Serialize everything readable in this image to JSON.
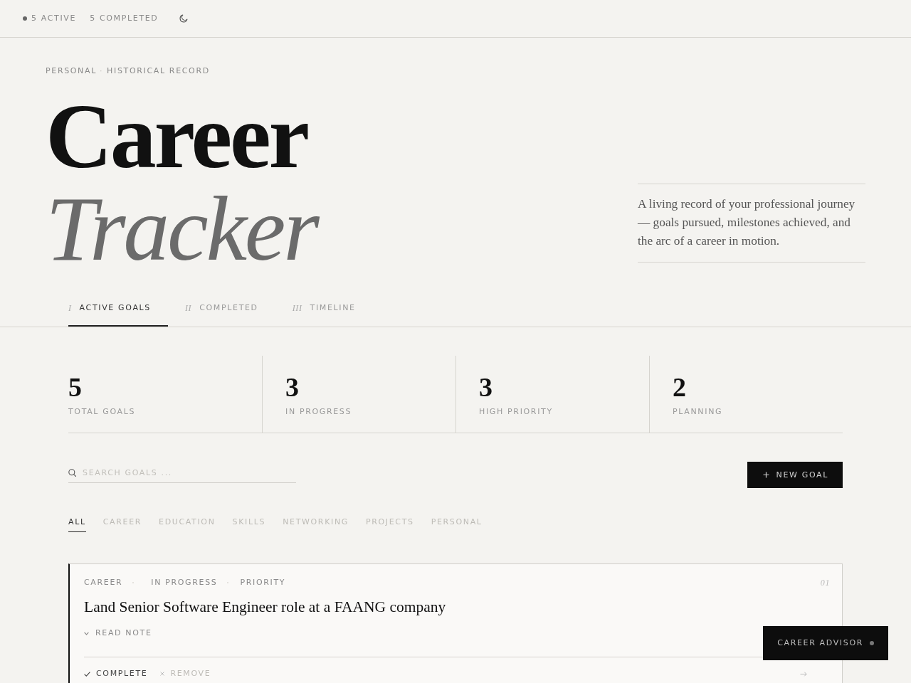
{
  "header": {
    "active": "5 ACTIVE",
    "completed": "5 COMPLETED"
  },
  "hero": {
    "breadcrumb": [
      "PERSONAL",
      "HISTORICAL RECORD"
    ],
    "separator": "·",
    "title": "Career",
    "title_accent": "Tracker",
    "description": "A living record of your professional journey — goals pursued, milestones achieved, and the arc of a career in motion."
  },
  "tabs": [
    {
      "numeral": "I",
      "label": "ACTIVE GOALS",
      "selected": true
    },
    {
      "numeral": "II",
      "label": "COMPLETED",
      "selected": false
    },
    {
      "numeral": "III",
      "label": "TIMELINE",
      "selected": false
    }
  ],
  "stats": [
    {
      "value": "5",
      "label": "TOTAL GOALS"
    },
    {
      "value": "3",
      "label": "IN PROGRESS"
    },
    {
      "value": "3",
      "label": "HIGH PRIORITY"
    },
    {
      "value": "2",
      "label": "PLANNING"
    }
  ],
  "search": {
    "placeholder": "SEARCH GOALS ..."
  },
  "new_goal_button": {
    "label": "NEW GOAL"
  },
  "filters": [
    {
      "label": "ALL",
      "selected": true
    },
    {
      "label": "CAREER",
      "selected": false
    },
    {
      "label": "EDUCATION",
      "selected": false
    },
    {
      "label": "SKILLS",
      "selected": false
    },
    {
      "label": "NETWORKING",
      "selected": false
    },
    {
      "label": "PROJECTS",
      "selected": false
    },
    {
      "label": "PERSONAL",
      "selected": false
    }
  ],
  "goals": [
    {
      "category": "CAREER",
      "status": "IN PROGRESS",
      "priority": "PRIORITY",
      "number": "01",
      "title": "Land Senior Software Engineer role at a FAANG company",
      "note_toggle": "READ NOTE",
      "expanded": false,
      "actions": [
        {
          "kind": "complete",
          "label": "COMPLETE"
        },
        {
          "kind": "remove",
          "label": "REMOVE"
        }
      ]
    }
  ],
  "advisor_button": {
    "label": "CAREER ADVISOR"
  }
}
